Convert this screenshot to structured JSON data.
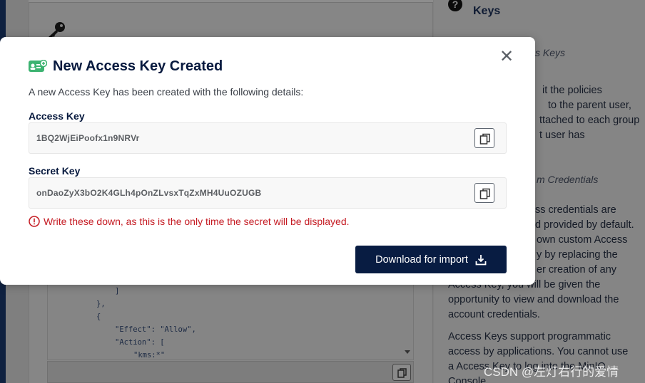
{
  "background": {
    "right_panel": {
      "title": "Keys",
      "italic_heading_1": "s Keys",
      "para_1": [
        "it the policies",
        "to the parent user,",
        "ttached to each group",
        "t user has"
      ],
      "italic_heading_2": "m Credentials",
      "para_2": [
        "ss credentials are",
        "d provided by default.",
        "own custom Access",
        "y by replacing the",
        "er creation of any",
        "Access Key, you will be given the",
        "opportunity to view and download the",
        "account credentials."
      ],
      "para_3": [
        "Access Keys support programmatic",
        "access by applications. You cannot use",
        "a Access Key to log into the MinIO",
        "Console."
      ]
    },
    "code_lines": [
      "]",
      "},",
      "{",
      "\"Effect\": \"Allow\",",
      "\"Action\": [",
      "\"kms:*\""
    ],
    "watermark": "CSDN @左灯右行的爱情"
  },
  "modal": {
    "title": "New Access Key Created",
    "description": "A new Access Key has been created with the following details:",
    "close_icon": "close-icon",
    "access_key": {
      "label": "Access Key",
      "value": "1BQ2WjEiPoofx1n9NRVr"
    },
    "secret_key": {
      "label": "Secret Key",
      "value": "onDaoZyX3bO2K4GLh4pOnZLvsxTqZxMH4UuOZUGB"
    },
    "warning": "Write these down, as this is the only time the secret will be displayed.",
    "download_button": "Download for import"
  },
  "colors": {
    "accent_navy": "#081c42",
    "warning_red": "#c51b23",
    "icon_green": "#3cb371"
  }
}
